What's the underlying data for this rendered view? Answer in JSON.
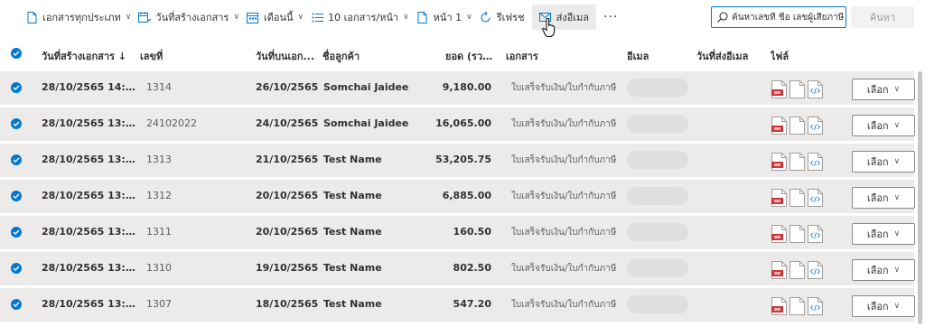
{
  "toolbar": {
    "doc_type": "เอกสารทุกประเภท",
    "created_date": "วันที่สร้างเอกสาร",
    "period": "เดือนนี้",
    "per_page": "10 เอกสาร/หน้า",
    "page": "หน้า 1",
    "refresh": "รีเฟรช",
    "send_email": "ส่งอีเมล",
    "more": "···",
    "search_placeholder": "ค้นหาเลขที่ ชื่อ เลขผู้เสียภาษี",
    "find_button": "ค้นหา"
  },
  "table": {
    "headers": {
      "created": "วันที่สร้างเอกสาร ↓",
      "number": "เลขที่",
      "doc_date": "วันที่บนเอก...",
      "customer": "ชื่อลูกค้า",
      "total": "ยอด (รวม...",
      "document": "เอกสาร",
      "email": "อีเมล",
      "email_date": "วันที่ส่งอีเมล",
      "files": "ไฟล์"
    },
    "rows": [
      {
        "created": "28/10/2565 14:11...",
        "number": "1314",
        "doc_date": "26/10/2565",
        "customer": "Somchai Jaidee",
        "total": "9,180.00",
        "document": "ใบเสร็จรับเงิน/ใบกำกับภาษี",
        "action": "เลือก"
      },
      {
        "created": "28/10/2565 13:48...",
        "number": "24102022",
        "doc_date": "24/10/2565",
        "customer": "Somchai Jaidee",
        "total": "16,065.00",
        "document": "ใบเสร็จรับเงิน/ใบกำกับภาษี",
        "action": "เลือก"
      },
      {
        "created": "28/10/2565 13:47...",
        "number": "1313",
        "doc_date": "21/10/2565",
        "customer": "Test Name",
        "total": "53,205.75",
        "document": "ใบเสร็จรับเงิน/ใบกำกับภาษี",
        "action": "เลือก"
      },
      {
        "created": "28/10/2565 13:47...",
        "number": "1312",
        "doc_date": "20/10/2565",
        "customer": "Test Name",
        "total": "6,885.00",
        "document": "ใบเสร็จรับเงิน/ใบกำกับภาษี",
        "action": "เลือก"
      },
      {
        "created": "28/10/2565 13:47...",
        "number": "1311",
        "doc_date": "20/10/2565",
        "customer": "Test Name",
        "total": "160.50",
        "document": "ใบเสร็จรับเงิน/ใบกำกับภาษี",
        "action": "เลือก"
      },
      {
        "created": "28/10/2565 13:47...",
        "number": "1310",
        "doc_date": "19/10/2565",
        "customer": "Test Name",
        "total": "802.50",
        "document": "ใบเสร็จรับเงิน/ใบกำกับภาษี",
        "action": "เลือก"
      },
      {
        "created": "28/10/2565 13:46...",
        "number": "1307",
        "doc_date": "18/10/2565",
        "customer": "Test Name",
        "total": "547.20",
        "document": "ใบเสร็จรับเงิน/ใบกำกับภาษี",
        "action": "เลือก"
      }
    ]
  },
  "colors": {
    "accent": "#0078d4",
    "row_bg": "#edebe9",
    "pdf_red": "#d13438"
  }
}
